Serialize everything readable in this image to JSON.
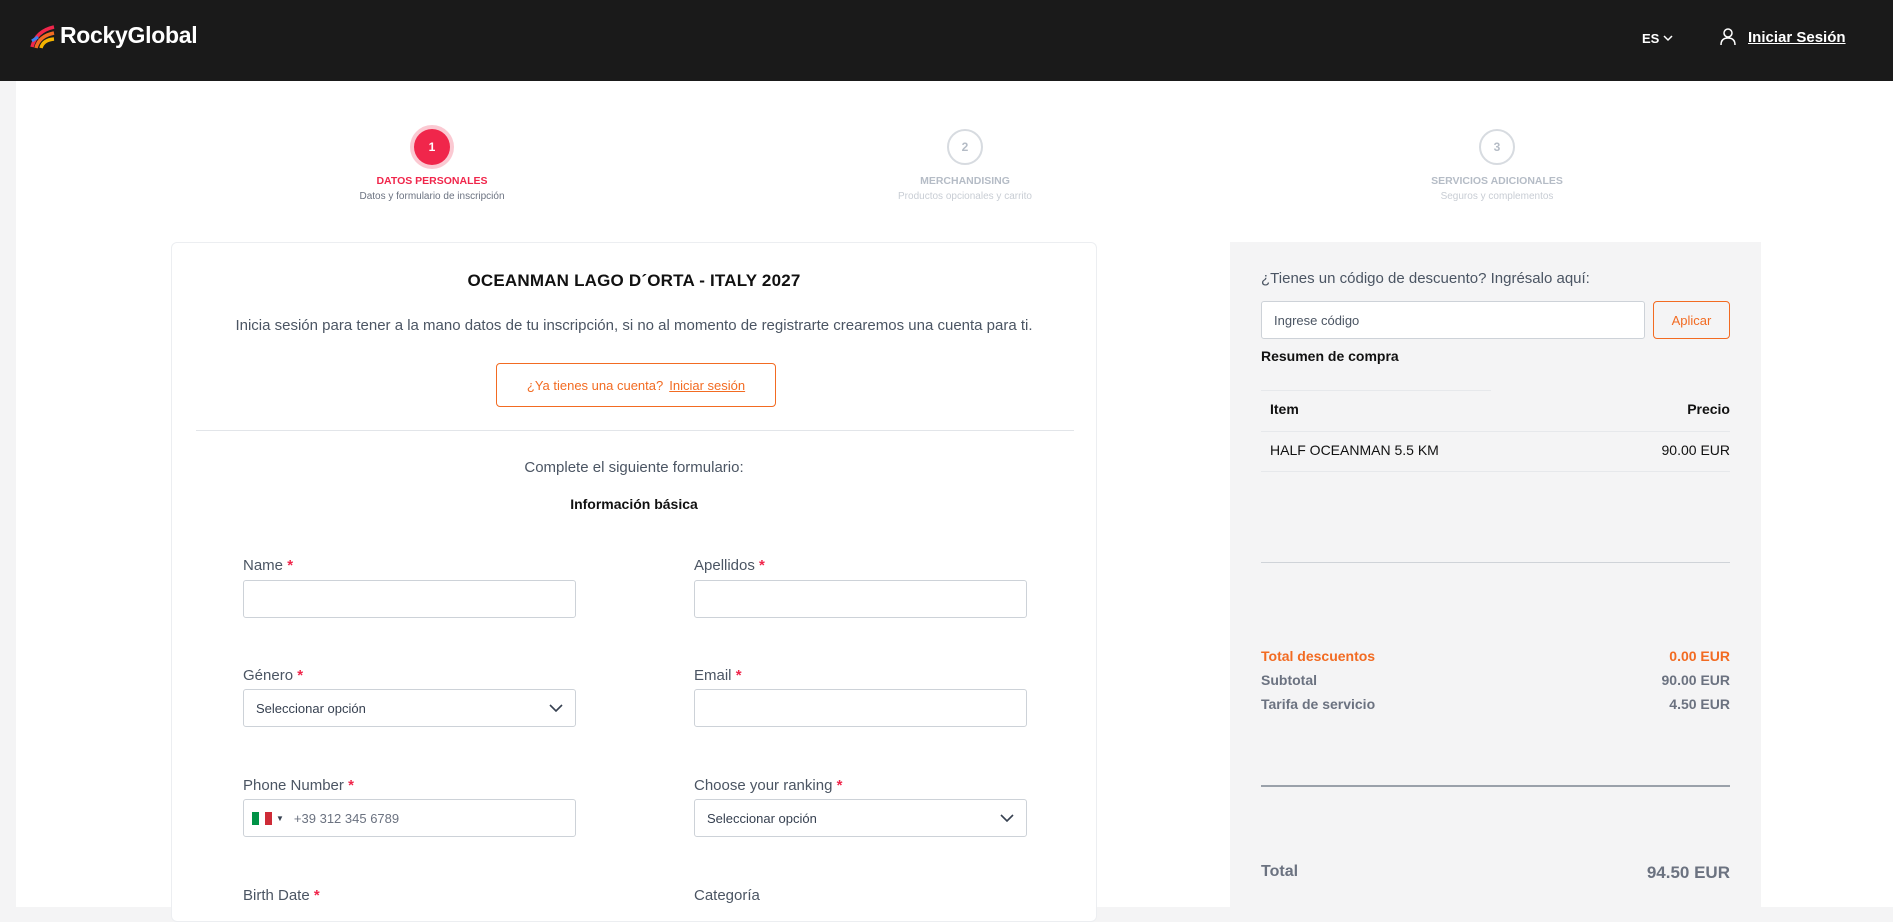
{
  "header": {
    "brand": "RockyGlobal",
    "language": "ES",
    "login_label": "Iniciar Sesión"
  },
  "steps": [
    {
      "number": "1",
      "title": "DATOS PERSONALES",
      "subtitle": "Datos y formulario de inscripción",
      "state": "active"
    },
    {
      "number": "2",
      "title": "MERCHANDISING",
      "subtitle": "Productos opcionales y carrito",
      "state": "inactive"
    },
    {
      "number": "3",
      "title": "SERVICIOS ADICIONALES",
      "subtitle": "Seguros y complementos",
      "state": "inactive"
    }
  ],
  "form": {
    "event_title": "OCEANMAN LAGO D´ORTA - ITALY 2027",
    "intro": "Inicia sesión para tener a la mano datos de tu inscripción, si no al momento de registrarte crearemos una cuenta para ti.",
    "account_question": "¿Ya tienes una cuenta?",
    "account_link": "Iniciar sesión",
    "complete_text": "Complete el siguiente formulario:",
    "section_title": "Información básica",
    "fields": {
      "name": {
        "label": "Name",
        "value": ""
      },
      "surname": {
        "label": "Apellidos",
        "value": ""
      },
      "gender": {
        "label": "Género",
        "value": "Seleccionar opción"
      },
      "email": {
        "label": "Email",
        "value": ""
      },
      "phone": {
        "label": "Phone Number",
        "placeholder": "+39 312 345 6789",
        "country": "Italy"
      },
      "ranking": {
        "label": "Choose your ranking",
        "value": "Seleccionar opción"
      },
      "birth_date": {
        "label": "Birth Date"
      },
      "category": {
        "label": "Categoría"
      }
    },
    "required_mark": "*"
  },
  "summary": {
    "discount_label": "¿Tienes un código de descuento? Ingrésalo aquí:",
    "discount_placeholder": "Ingrese código",
    "apply_label": "Aplicar",
    "title": "Resumen de compra",
    "col_item": "Item",
    "col_price": "Precio",
    "items": [
      {
        "name": "HALF OCEANMAN 5.5 KM",
        "price": "90.00 EUR"
      }
    ],
    "total_discounts_label": "Total descuentos",
    "total_discounts_value": "0.00 EUR",
    "subtotal_label": "Subtotal",
    "subtotal_value": "90.00 EUR",
    "service_fee_label": "Tarifa de servicio",
    "service_fee_value": "4.50 EUR",
    "total_label": "Total",
    "total_value": "94.50 EUR"
  },
  "colors": {
    "accent_red": "#f0264b",
    "accent_orange": "#f26b22",
    "header_bg": "#1a1a1a"
  }
}
